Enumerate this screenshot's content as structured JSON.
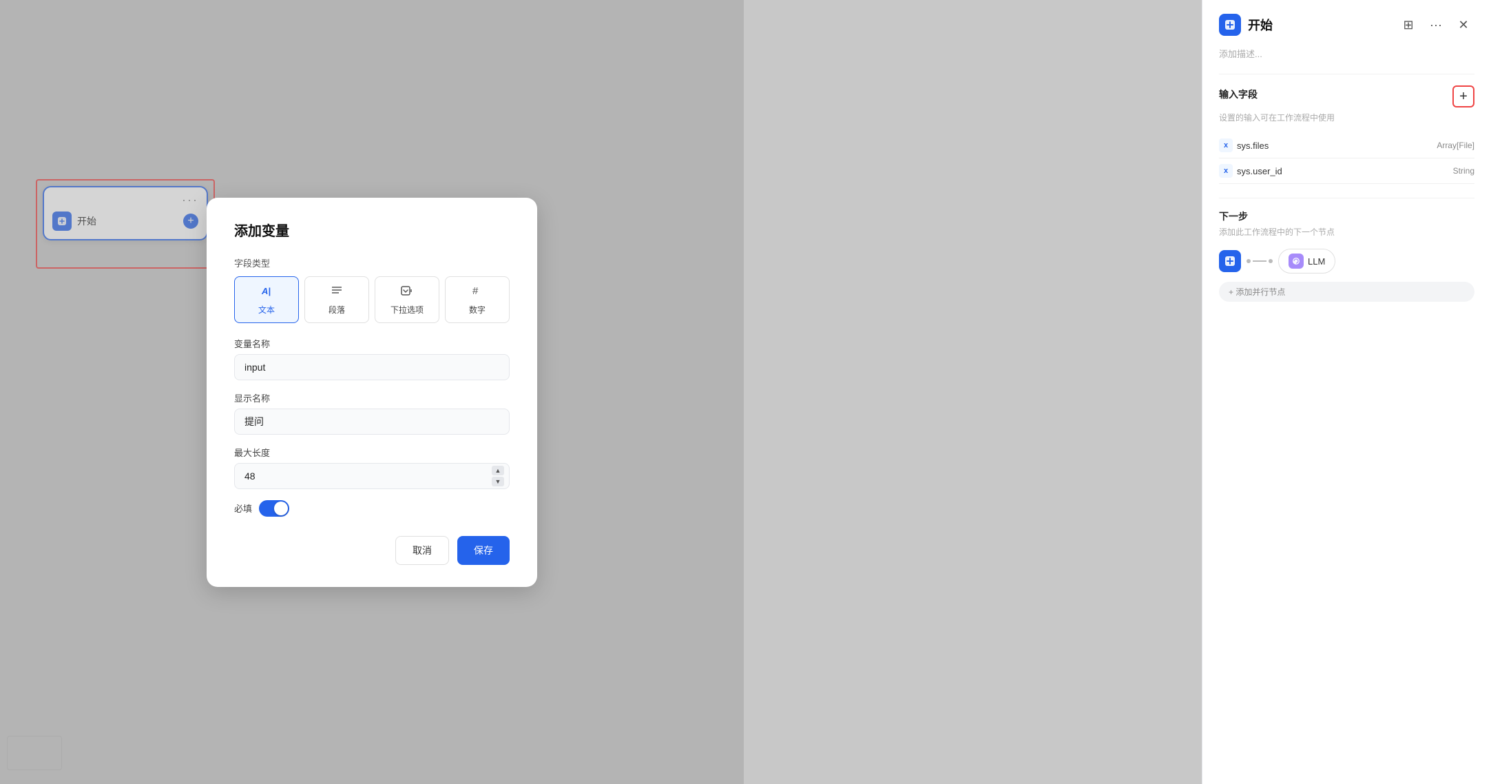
{
  "canvas": {
    "node": {
      "title": "开始",
      "dots_label": "···",
      "add_label": "+"
    },
    "connector": {}
  },
  "modal": {
    "title": "添加变量",
    "field_type_label": "字段类型",
    "types": [
      {
        "id": "text",
        "icon": "Ａ|",
        "label": "文本",
        "active": true
      },
      {
        "id": "paragraph",
        "icon": "≡",
        "label": "段落",
        "active": false
      },
      {
        "id": "dropdown",
        "icon": "⬡",
        "label": "下拉选项",
        "active": false
      },
      {
        "id": "number",
        "icon": "#",
        "label": "数字",
        "active": false
      }
    ],
    "variable_name_label": "变量名称",
    "variable_name_value": "input",
    "variable_name_placeholder": "input",
    "display_name_label": "显示名称",
    "display_name_value": "提问",
    "display_name_placeholder": "提问",
    "max_length_label": "最大长度",
    "max_length_value": "48",
    "required_label": "必填",
    "toggle_on": true,
    "cancel_label": "取消",
    "save_label": "保存"
  },
  "panel": {
    "title": "开始",
    "description_placeholder": "添加描述...",
    "input_fields_title": "输入字段",
    "input_fields_add_tooltip": "+",
    "input_fields_sub": "设置的输入可在工作流程中使用",
    "fields": [
      {
        "name": "sys.files",
        "type": "Array[File]"
      },
      {
        "name": "sys.user_id",
        "type": "String"
      }
    ],
    "next_step_title": "下一步",
    "next_step_sub": "添加此工作流程中的下一个节点",
    "llm_label": "LLM",
    "add_parallel_label": "+ 添加并行节点",
    "layout_icon": "⊞",
    "more_icon": "···",
    "close_icon": "✕"
  },
  "icons": {
    "home_unicode": "⌂",
    "x_unicode": "{x}"
  }
}
